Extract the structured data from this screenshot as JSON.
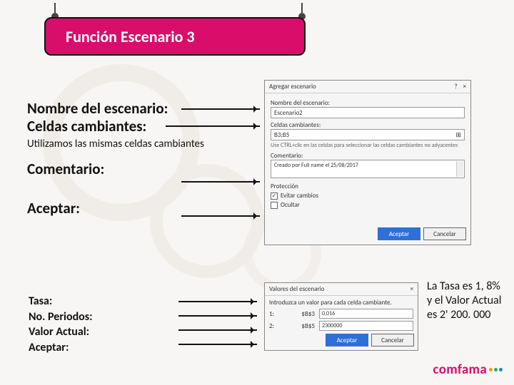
{
  "title": "Función Escenario 3",
  "bullets": {
    "l1": "Nombre del escenario:",
    "l2": "Celdas cambiantes:",
    "note": "Utilizamos las mismas celdas cambiantes",
    "l3": "Comentario:",
    "l4": "Aceptar:"
  },
  "dialog1": {
    "title": "Agregar escenario",
    "help": "?",
    "close": "×",
    "lbl_name": "Nombre del escenario:",
    "val_name": "Escenario2",
    "lbl_cells": "Celdas cambiantes:",
    "val_cells": "B3;B5",
    "cell_icon": "⊞",
    "hint": "Use CTRL+clic en las celdas para seleccionar las celdas cambiantes no adyacentes",
    "lbl_comment": "Comentario:",
    "val_comment": "Creado por Full name el 25/08/2017",
    "section": "Protección",
    "chk1_checked": "✓",
    "chk1": "Evitar cambios",
    "chk2": "Ocultar",
    "ok": "Aceptar",
    "cancel": "Cancelar"
  },
  "dialog2": {
    "title": "Valores del escenario",
    "close": "×",
    "intro": "Introduzca un valor para cada celda cambiante.",
    "r1_idx": "1:",
    "r1_cell": "$B$3",
    "r1_val": "0,016",
    "r2_idx": "2:",
    "r2_cell": "$B$5",
    "r2_val": "2300000",
    "ok": "Aceptar",
    "cancel": "Cancelar"
  },
  "list2": {
    "a": "Tasa:",
    "b": "No. Periodos:",
    "c": "Valor Actual:",
    "d": "Aceptar:"
  },
  "note_right": "La Tasa es 1, 8% y el Valor Actual es 2' 200. 000",
  "logo": {
    "text": "comfama"
  }
}
